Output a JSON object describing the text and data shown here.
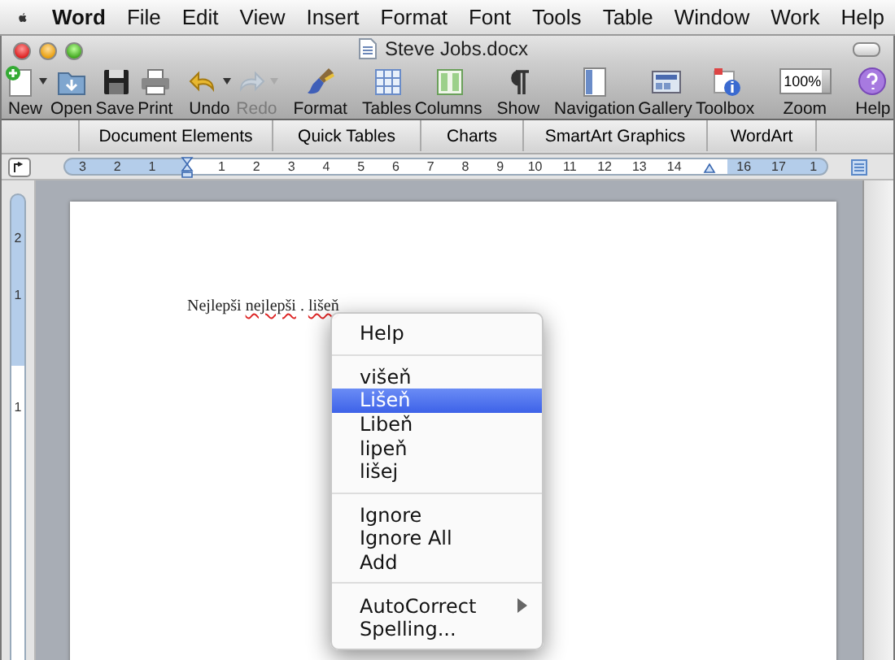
{
  "menubar": {
    "app": "Word",
    "items": [
      "File",
      "Edit",
      "View",
      "Insert",
      "Format",
      "Font",
      "Tools",
      "Table",
      "Window",
      "Work",
      "Help"
    ]
  },
  "window": {
    "title": "Steve Jobs.docx"
  },
  "toolbar": {
    "groups": [
      [
        {
          "kind": "button",
          "label": "New",
          "disabled": false,
          "dropdown": true
        },
        {
          "kind": "button",
          "label": "Open",
          "disabled": false,
          "dropdown": false
        },
        {
          "kind": "button",
          "label": "Save",
          "disabled": false,
          "dropdown": false
        },
        {
          "kind": "button",
          "label": "Print",
          "disabled": false,
          "dropdown": false
        }
      ],
      [
        {
          "kind": "button",
          "label": "Undo",
          "disabled": false,
          "dropdown": true
        },
        {
          "kind": "button",
          "label": "Redo",
          "disabled": true,
          "dropdown": true
        }
      ],
      [
        {
          "kind": "button",
          "label": "Format",
          "disabled": false,
          "dropdown": false
        }
      ],
      [
        {
          "kind": "button",
          "label": "Tables",
          "disabled": false,
          "dropdown": false
        },
        {
          "kind": "button",
          "label": "Columns",
          "disabled": false,
          "dropdown": false
        }
      ],
      [
        {
          "kind": "button",
          "label": "Show",
          "disabled": false,
          "dropdown": false
        }
      ],
      [
        {
          "kind": "button",
          "label": "Navigation",
          "disabled": false,
          "dropdown": false
        },
        {
          "kind": "button",
          "label": "Gallery",
          "disabled": false,
          "dropdown": false
        },
        {
          "kind": "button",
          "label": "Toolbox",
          "disabled": false,
          "dropdown": false
        }
      ],
      [
        {
          "kind": "combo",
          "label": "Zoom",
          "value": "100%"
        }
      ],
      [
        {
          "kind": "button",
          "label": "Help",
          "disabled": false,
          "dropdown": false
        }
      ]
    ]
  },
  "ribbon_tabs": [
    "Document Elements",
    "Quick Tables",
    "Charts",
    "SmartArt Graphics",
    "WordArt"
  ],
  "ruler": [
    {
      "kind": "number",
      "text": "3"
    },
    {
      "kind": "number",
      "text": "2"
    },
    {
      "kind": "number",
      "text": "1"
    },
    {
      "kind": "indent"
    },
    {
      "kind": "number",
      "text": "1"
    },
    {
      "kind": "number",
      "text": "2"
    },
    {
      "kind": "number",
      "text": "3"
    },
    {
      "kind": "number",
      "text": "4"
    },
    {
      "kind": "number",
      "text": "5"
    },
    {
      "kind": "number",
      "text": "6"
    },
    {
      "kind": "number",
      "text": "7"
    },
    {
      "kind": "number",
      "text": "8"
    },
    {
      "kind": "number",
      "text": "9"
    },
    {
      "kind": "number",
      "text": "10"
    },
    {
      "kind": "number",
      "text": "11"
    },
    {
      "kind": "number",
      "text": "12"
    },
    {
      "kind": "number",
      "text": "13"
    },
    {
      "kind": "number",
      "text": "14"
    },
    {
      "kind": "right-indent"
    },
    {
      "kind": "number",
      "text": "16"
    },
    {
      "kind": "number",
      "text": "17"
    },
    {
      "kind": "number",
      "text": "1"
    }
  ],
  "vertical_ruler": [
    "2",
    "1",
    "1"
  ],
  "document": {
    "runs": [
      {
        "text": "Nejlepši ",
        "misspelled": false
      },
      {
        "text": "nejlepši",
        "misspelled": true
      },
      {
        "text": " . ",
        "misspelled": false
      },
      {
        "text": "lišeň",
        "misspelled": true
      }
    ]
  },
  "context_menu": {
    "sections": [
      [
        {
          "label": "Help",
          "selected": false,
          "submenu": false
        }
      ],
      [
        {
          "label": "višeň",
          "selected": false,
          "submenu": false
        },
        {
          "label": "Lišeň",
          "selected": true,
          "submenu": false
        },
        {
          "label": "Libeň",
          "selected": false,
          "submenu": false
        },
        {
          "label": "lipeň",
          "selected": false,
          "submenu": false
        },
        {
          "label": "lišej",
          "selected": false,
          "submenu": false
        }
      ],
      [
        {
          "label": "Ignore",
          "selected": false,
          "submenu": false
        },
        {
          "label": "Ignore All",
          "selected": false,
          "submenu": false
        },
        {
          "label": "Add",
          "selected": false,
          "submenu": false
        }
      ],
      [
        {
          "label": "AutoCorrect",
          "selected": false,
          "submenu": true
        },
        {
          "label": "Spelling...",
          "selected": false,
          "submenu": false
        }
      ]
    ]
  }
}
